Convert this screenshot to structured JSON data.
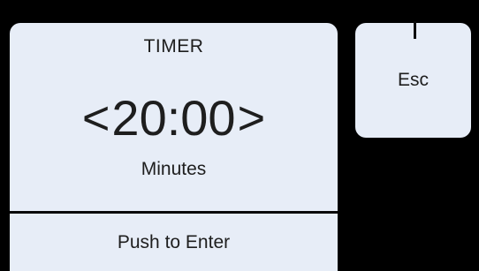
{
  "timer": {
    "title": "TIMER",
    "decrease_label": "<",
    "value": "20:00",
    "increase_label": ">",
    "unit": "Minutes",
    "enter_label": "Push to Enter"
  },
  "esc": {
    "label": "Esc"
  },
  "colors": {
    "background": "#000000",
    "panel": "#e7edf7",
    "text": "#1e1e1e"
  }
}
